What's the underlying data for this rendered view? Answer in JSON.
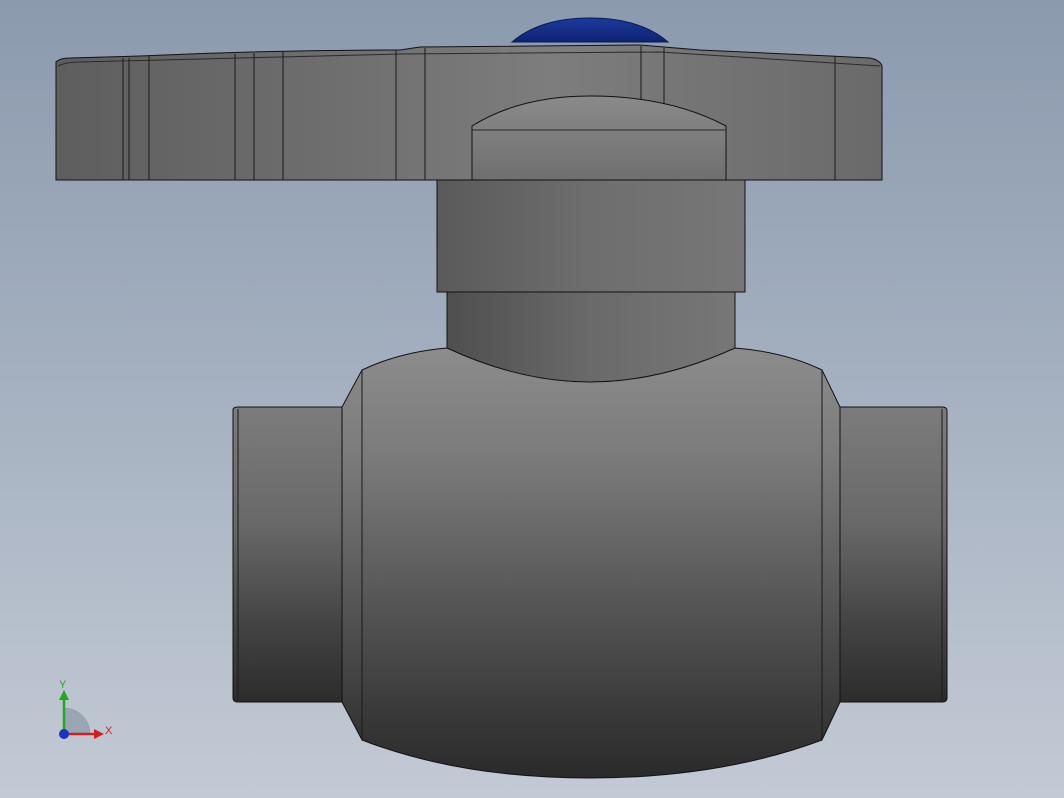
{
  "viewport": {
    "background_top": "#8c9aae",
    "background_bottom": "#c3cad5",
    "model": {
      "name": "ball-valve",
      "body_color": "#6a6a6a",
      "cap_color": "#1a3a9c"
    }
  },
  "triad": {
    "y_label": "Y",
    "x_label": "X",
    "y_color": "#1faa1f",
    "x_color": "#d02020",
    "z_color": "#2030c0"
  }
}
